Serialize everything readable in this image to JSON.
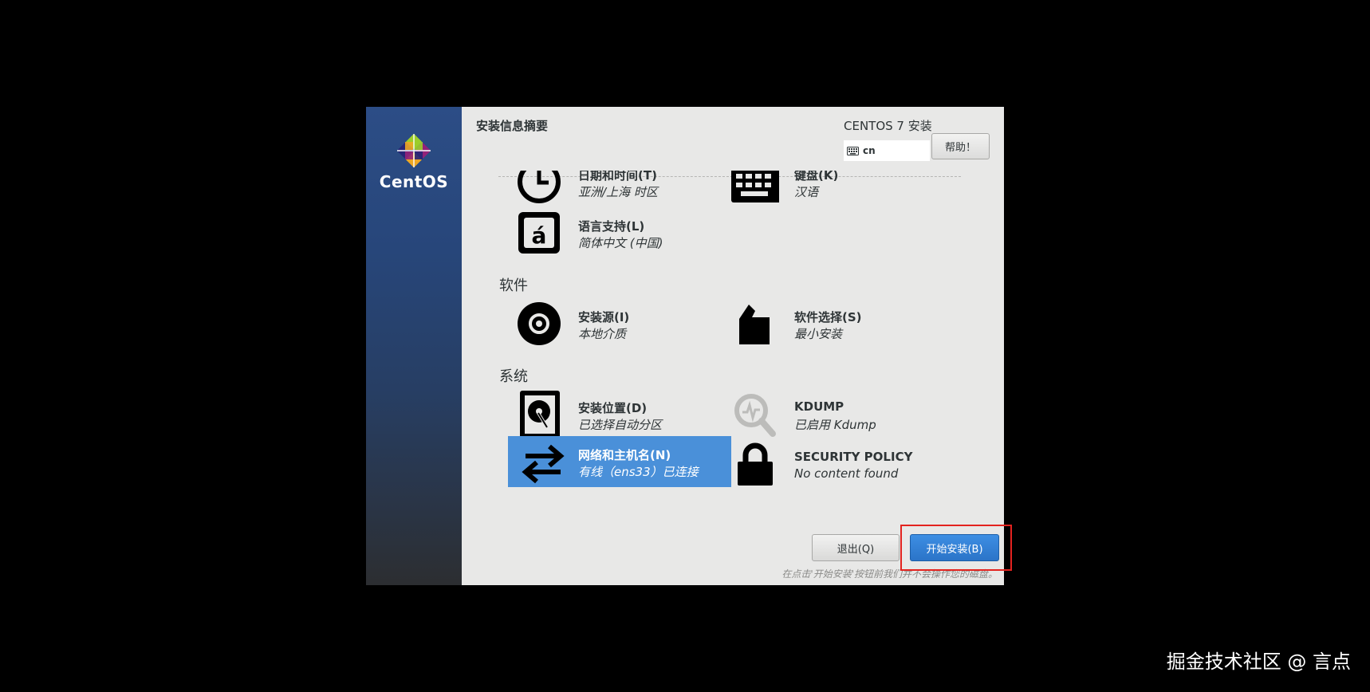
{
  "header": {
    "page_title": "安装信息摘要",
    "product_title": "CENTOS 7 安装",
    "keyboard_layout": "cn",
    "help_label": "帮助！"
  },
  "branding": {
    "logo_text": "CentOS"
  },
  "sections": {
    "software_label": "软件",
    "system_label": "系统"
  },
  "spokes": {
    "datetime": {
      "title": "日期和时间(T)",
      "status": "亚洲/上海 时区",
      "icon": "clock-icon"
    },
    "keyboard": {
      "title": "键盘(K)",
      "status": "汉语",
      "icon": "keyboard-icon"
    },
    "language": {
      "title": "语言支持(L)",
      "status": "简体中文 (中国)",
      "icon": "language-icon"
    },
    "source": {
      "title": "安装源(I)",
      "status": "本地介质",
      "icon": "disc-icon"
    },
    "software": {
      "title": "软件选择(S)",
      "status": "最小安装",
      "icon": "package-icon"
    },
    "destination": {
      "title": "安装位置(D)",
      "status": "已选择自动分区",
      "icon": "harddisk-icon"
    },
    "kdump": {
      "title": "KDUMP",
      "status": "已启用 Kdump",
      "icon": "kdump-search-icon"
    },
    "network": {
      "title": "网络和主机名(N)",
      "status": "有线（ens33）已连接",
      "icon": "network-arrows-icon"
    },
    "security": {
      "title": "SECURITY POLICY",
      "status": "No content found",
      "icon": "lock-icon"
    }
  },
  "footer": {
    "quit_label": "退出(Q)",
    "begin_label": "开始安装(B)",
    "note": "在点击'开始安装'按钮前我们并不会操作您的磁盘。"
  },
  "watermark": "掘金技术社区 @ 言点",
  "colors": {
    "selected_spoke": "#4a90d9",
    "primary_button": "#2b74c8",
    "highlight_box": "#e3231f",
    "sidebar": "#27467a"
  }
}
